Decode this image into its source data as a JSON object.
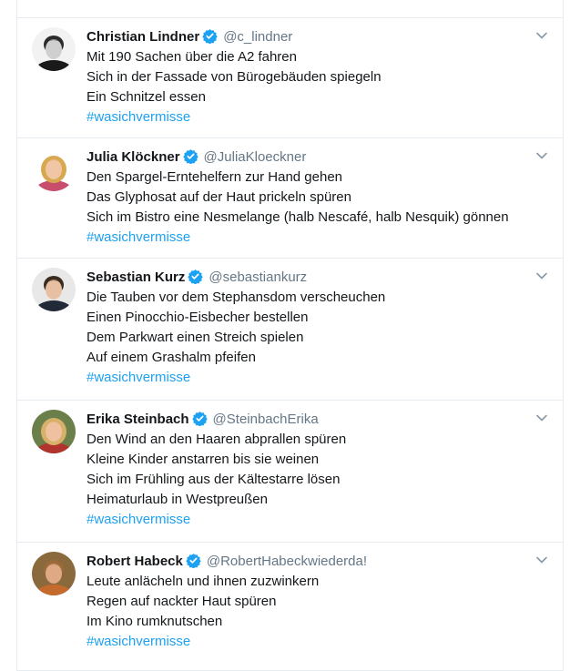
{
  "tweets": [
    {
      "name": "Christian Lindner",
      "handle": "@c_lindner",
      "lines": [
        "Mit 190 Sachen über die A2 fahren",
        "Sich in der Fassade von Bürogebäuden spiegeln",
        "Ein Schnitzel essen"
      ],
      "hashtag": "#wasichvermisse",
      "avatar_colors": {
        "bg": "#f2f2f2",
        "hair": "#2b2b2b",
        "face": "#cfcfcf",
        "shirt": "#1a1a1a"
      }
    },
    {
      "name": "Julia Klöckner",
      "handle": "@JuliaKloeckner",
      "lines": [
        "Den Spargel-Erntehelfern zur Hand gehen",
        "Das Glyphosat auf der Haut prickeln spüren",
        "Sich im Bistro eine Nesmelange (halb Nescafé, halb Nesquik) gönnen"
      ],
      "hashtag": "#wasichvermisse",
      "avatar_colors": {
        "bg": "#ffffff",
        "hair": "#d8a850",
        "face": "#f1c6a5",
        "shirt": "#c94e6b"
      }
    },
    {
      "name": "Sebastian Kurz",
      "handle": "@sebastiankurz",
      "lines": [
        "Die Tauben vor dem Stephansdom verscheuchen",
        "Einen Pinocchio-Eisbecher bestellen",
        "Dem Parkwart einen Streich spielen",
        "Auf einem Grashalm pfeifen"
      ],
      "hashtag": "#wasichvermisse",
      "avatar_colors": {
        "bg": "#e8e8e8",
        "hair": "#3b2a1e",
        "face": "#e7c0a4",
        "shirt": "#222a3a"
      }
    },
    {
      "name": "Erika Steinbach",
      "handle": "@SteinbachErika",
      "lines": [
        "Den Wind an den Haaren abprallen spüren",
        "Kleine Kinder anstarren bis sie weinen",
        "Sich im Frühling aus der Kältestarre lösen",
        "Heimaturlaub in Westpreußen"
      ],
      "hashtag": "#wasichvermisse",
      "avatar_colors": {
        "bg": "#6b7f4a",
        "hair": "#d7b169",
        "face": "#f0c1a0",
        "shirt": "#b0332e"
      }
    },
    {
      "name": "Robert Habeck",
      "handle": "@RobertHabeckwiederda!",
      "lines": [
        "Leute anlächeln und ihnen zuzwinkern",
        "Regen auf nackter Haut spüren",
        "Im Kino rumknutschen"
      ],
      "hashtag": "#wasichvermisse",
      "avatar_colors": {
        "bg": "#8a6a3c",
        "hair": "#9a6a3a",
        "face": "#e0a985",
        "shirt": "#c46a2c"
      }
    }
  ],
  "theme": {
    "link": "#1da1f2",
    "verified": "#1da1f2",
    "handle": "#657786",
    "border": "#e6ecf0"
  },
  "icons": {
    "verified": "verified-badge-icon",
    "caret": "chevron-down-icon"
  }
}
